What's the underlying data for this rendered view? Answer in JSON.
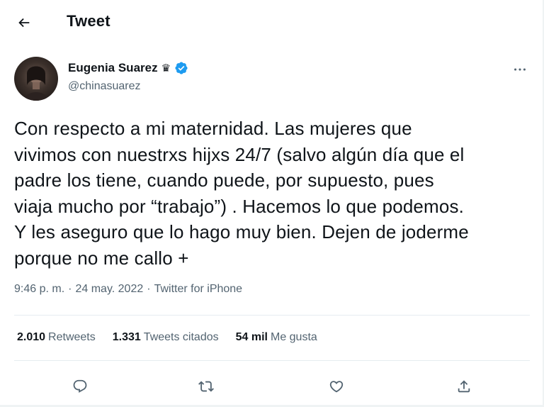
{
  "header": {
    "title": "Tweet",
    "back_icon": "arrow-left-icon"
  },
  "author": {
    "display_name": "Eugenia Suarez",
    "crown_emoji": "♛",
    "handle": "@chinasuarez",
    "verified": true
  },
  "tweet": {
    "lines": [
      "Con respecto a mi maternidad. Las mujeres que",
      "vivimos con nuestrxs hijxs 24/7 (salvo algún día que el",
      "padre los tiene, cuando puede, por supuesto, pues",
      "viaja mucho por “trabajo”) . Hacemos lo que podemos.",
      "Y les aseguro que lo hago muy bien. Dejen de joderme",
      "porque no me callo +"
    ]
  },
  "meta": {
    "time": "9:46 p. m.",
    "sep1": "·",
    "date": "24 may. 2022",
    "sep2": "·",
    "source": "Twitter for iPhone"
  },
  "stats": {
    "retweets_count": "2.010",
    "retweets_label": "Retweets",
    "quotes_count": "1.331",
    "quotes_label": "Tweets citados",
    "likes_count": "54 mil",
    "likes_label": "Me gusta"
  },
  "colors": {
    "text": "#0f1419",
    "secondary": "#536471",
    "verified_blue": "#1d9bf0",
    "divider": "#e6ecf0"
  },
  "icons": {
    "reply": "reply-icon",
    "retweet": "retweet-icon",
    "like": "heart-icon",
    "share": "share-icon",
    "more": "more-icon"
  }
}
